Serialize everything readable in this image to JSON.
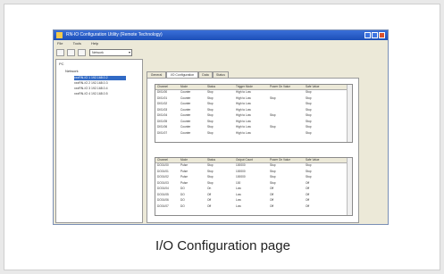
{
  "window": {
    "title": "RN-IO Configuration Utility (Remote Technology)"
  },
  "menu": [
    "File",
    "Tools",
    "Help"
  ],
  "toolbar": {
    "dropdown_value": "Network"
  },
  "tree": {
    "root": "PC",
    "network": "Network",
    "nodes": [
      "xxxRN-IO 1 192.168.0.2",
      "xxxRN-IO 2 192.168.0.3",
      "xxxRN-IO 3 192.168.0.4",
      "xxxRN-IO 4 192.168.0.5"
    ]
  },
  "tabs": [
    "General",
    "I/O Configuration",
    "Data",
    "Status"
  ],
  "input_grid": {
    "headers": [
      "Channel",
      "Mode",
      "Status",
      "Trigger Mode",
      "Power On Value",
      "Safe Value"
    ],
    "rows": [
      [
        "DI01/00",
        "Counter",
        "Stop",
        "High to Low",
        "",
        "Stop"
      ],
      [
        "DI01/01",
        "Counter",
        "Stop",
        "High to Low",
        "Stop",
        "Stop"
      ],
      [
        "DI01/02",
        "Counter",
        "Stop",
        "High to Low",
        "",
        "Stop"
      ],
      [
        "DI01/03",
        "Counter",
        "Stop",
        "High to Low",
        "",
        "Stop"
      ],
      [
        "DI01/04",
        "Counter",
        "Stop",
        "High to Low",
        "Stop",
        "Stop"
      ],
      [
        "DI01/05",
        "Counter",
        "Stop",
        "High to Low",
        "",
        "Stop"
      ],
      [
        "DI01/06",
        "Counter",
        "Stop",
        "High to Low",
        "Stop",
        "Stop"
      ],
      [
        "DI01/07",
        "Counter",
        "Stop",
        "High to Low",
        "",
        "Stop"
      ]
    ]
  },
  "output_grid": {
    "headers": [
      "Channel",
      "Mode",
      "Status",
      "Output Count",
      "Power On Value",
      "Safe Value"
    ],
    "rows": [
      [
        "DO01/00",
        "Pulse",
        "Stop",
        "100000",
        "Stop",
        "Stop"
      ],
      [
        "DO01/01",
        "Pulse",
        "Stop",
        "100000",
        "Stop",
        "Stop"
      ],
      [
        "DO01/02",
        "Pulse",
        "Stop",
        "100000",
        "Stop",
        "Stop"
      ],
      [
        "DO01/03",
        "Pulse",
        "Stop",
        "100",
        "Stop",
        "Off"
      ],
      [
        "DO01/04",
        "DO",
        "On",
        "Low",
        "Off",
        "Off"
      ],
      [
        "DO01/05",
        "DO",
        "Off",
        "Low",
        "Off",
        "Off"
      ],
      [
        "DO01/06",
        "DO",
        "Off",
        "Low",
        "Off",
        "Off"
      ],
      [
        "DO01/07",
        "DO",
        "Off",
        "Low",
        "Off",
        "Off"
      ]
    ]
  },
  "caption": "I/O Configuration page"
}
